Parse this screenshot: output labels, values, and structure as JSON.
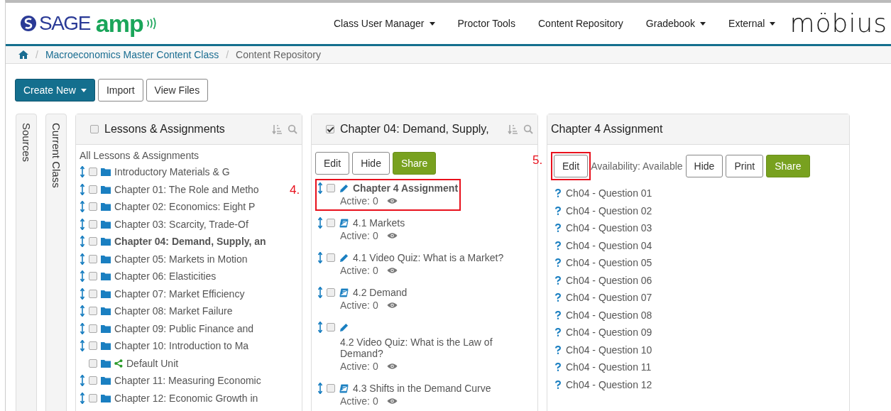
{
  "header": {
    "logo": {
      "brand": "SAGE",
      "product": "amp"
    },
    "nav": [
      {
        "label": "Class User Manager",
        "has_menu": true
      },
      {
        "label": "Proctor Tools",
        "has_menu": false
      },
      {
        "label": "Content Repository",
        "has_menu": false
      },
      {
        "label": "Gradebook",
        "has_menu": true
      },
      {
        "label": "External",
        "has_menu": true
      }
    ],
    "partner_logo": "möbius"
  },
  "breadcrumb": {
    "separator": "/",
    "items": [
      "Macroeconomics Master Content Class",
      "Content Repository"
    ]
  },
  "toolbar": [
    {
      "label": "Create New",
      "kind": "primary",
      "has_menu": true
    },
    {
      "label": "Import",
      "kind": "default",
      "has_menu": false
    },
    {
      "label": "View Files",
      "kind": "default",
      "has_menu": false
    }
  ],
  "side_tabs": [
    "Sources",
    "Current Class"
  ],
  "lessons_panel": {
    "title": "Lessons & Assignments",
    "checked": false,
    "root": "All Lessons & Assignments",
    "items": [
      {
        "label": "Introductory Materials & G",
        "kind": "folder",
        "checked": false,
        "selected": false
      },
      {
        "label": "Chapter 01: The Role and Metho",
        "kind": "folder",
        "checked": false,
        "selected": false
      },
      {
        "label": "Chapter 02: Economics: Eight P",
        "kind": "folder",
        "checked": false,
        "selected": false
      },
      {
        "label": "Chapter 03: Scarcity, Trade-Of",
        "kind": "folder",
        "checked": false,
        "selected": false
      },
      {
        "label": "Chapter 04: Demand, Supply, an",
        "kind": "folder",
        "checked": false,
        "selected": true
      },
      {
        "label": "Chapter 05: Markets in Motion",
        "kind": "folder",
        "checked": false,
        "selected": false
      },
      {
        "label": "Chapter 06: Elasticities",
        "kind": "folder",
        "checked": false,
        "selected": false
      },
      {
        "label": "Chapter 07: Market Efficiency",
        "kind": "folder",
        "checked": false,
        "selected": false
      },
      {
        "label": "Chapter 08: Market Failure",
        "kind": "folder",
        "checked": false,
        "selected": false
      },
      {
        "label": "Chapter 09: Public Finance and",
        "kind": "folder",
        "checked": false,
        "selected": false
      },
      {
        "label": "Chapter 10: Introduction to Ma",
        "kind": "folder",
        "checked": false,
        "selected": false
      },
      {
        "label": "Default Unit",
        "kind": "shared",
        "checked": false,
        "selected": false
      },
      {
        "label": "Chapter 11: Measuring Economic",
        "kind": "folder",
        "checked": false,
        "selected": false
      },
      {
        "label": "Chapter 12: Economic Growth in",
        "kind": "folder",
        "checked": false,
        "selected": false
      }
    ]
  },
  "chapter_panel": {
    "title": "Chapter 04: Demand, Supply,",
    "checked": true,
    "buttons": [
      {
        "label": "Edit",
        "kind": "default"
      },
      {
        "label": "Hide",
        "kind": "default"
      },
      {
        "label": "Share",
        "kind": "success"
      }
    ],
    "items": [
      {
        "title": "Chapter 4 Assignment",
        "kind": "assignment",
        "checked": false,
        "selected": true,
        "active": "Active: 0",
        "callout": "4."
      },
      {
        "title": "4.1 Markets",
        "kind": "lesson",
        "checked": false,
        "selected": false,
        "active": "Active: 0"
      },
      {
        "title": "4.1 Video Quiz: What is a Market?",
        "kind": "assignment",
        "checked": false,
        "selected": false,
        "active": "Active: 0"
      },
      {
        "title": "4.2 Demand",
        "kind": "lesson",
        "checked": false,
        "selected": false,
        "active": "Active: 0"
      },
      {
        "title": "4.2 Video Quiz: What is the Law of Demand?",
        "kind": "assignment",
        "checked": false,
        "selected": false,
        "active": "Active: 0"
      },
      {
        "title": "4.3 Shifts in the Demand Curve",
        "kind": "lesson",
        "checked": false,
        "selected": false,
        "active": "Active: 0"
      }
    ]
  },
  "assignment_panel": {
    "title": "Chapter 4 Assignment",
    "edit_button": {
      "label": "Edit",
      "highlighted": true,
      "callout": "5."
    },
    "availability": "Availability: Available",
    "buttons": [
      {
        "label": "Hide",
        "kind": "default"
      },
      {
        "label": "Print",
        "kind": "default"
      },
      {
        "label": "Share",
        "kind": "success"
      }
    ],
    "questions": [
      "Ch04 - Question 01",
      "Ch04 - Question 02",
      "Ch04 - Question 03",
      "Ch04 - Question 04",
      "Ch04 - Question 05",
      "Ch04 - Question 06",
      "Ch04 - Question 07",
      "Ch04 - Question 08",
      "Ch04 - Question 09",
      "Ch04 - Question 10",
      "Ch04 - Question 11",
      "Ch04 - Question 12"
    ]
  }
}
